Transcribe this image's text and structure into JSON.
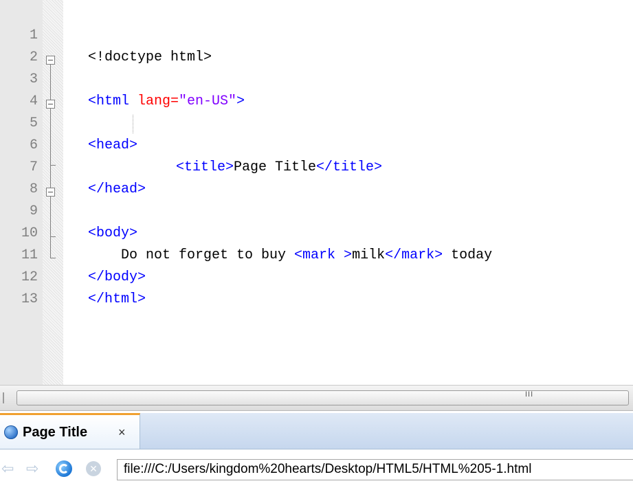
{
  "editor": {
    "lines": [
      {
        "num": "1",
        "parts": [
          "<!doctype html>"
        ]
      },
      {
        "num": "2",
        "parts": []
      },
      {
        "num": "3",
        "parts": [
          "<html ",
          "lang=",
          "\"en-US\"",
          ">"
        ]
      },
      {
        "num": "4",
        "parts": []
      },
      {
        "num": "5",
        "parts": [
          "<head>"
        ]
      },
      {
        "num": "6",
        "parts": [
          "<title>",
          "Page Title",
          "</title>"
        ]
      },
      {
        "num": "7",
        "parts": [
          "</head>"
        ]
      },
      {
        "num": "8",
        "parts": []
      },
      {
        "num": "9",
        "parts": [
          "<body>"
        ]
      },
      {
        "num": "10",
        "parts": [
          "Do not forget to buy ",
          "<mark >",
          "milk",
          "</mark>",
          " today"
        ]
      },
      {
        "num": "11",
        "parts": [
          "</body>"
        ]
      },
      {
        "num": "12",
        "parts": [
          "</html>"
        ]
      },
      {
        "num": "13",
        "parts": []
      }
    ],
    "colors": {
      "tag": "#0000ff",
      "attribute": "#ff0000",
      "value": "#8000ff",
      "text": "#000000",
      "line_number": "#808080"
    }
  },
  "scrollbar": {
    "grip": "III"
  },
  "browser": {
    "tab": {
      "title": "Page Title",
      "close": "×",
      "icon": "browser-globe-icon"
    },
    "nav": {
      "back_icon": "back-arrow-icon",
      "forward_icon": "forward-arrow-icon",
      "refresh_icon": "refresh-icon",
      "stop_icon": "stop-icon"
    },
    "address": "file:///C:/Users/kingdom%20hearts/Desktop/HTML5/HTML%205-1.html"
  }
}
